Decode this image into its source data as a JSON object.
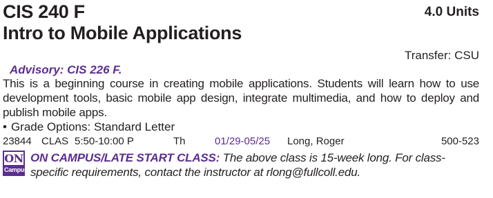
{
  "course": {
    "code": "CIS 240 F",
    "units": "4.0 Units",
    "title": "Intro to Mobile Applications",
    "transfer": "Transfer: CSU",
    "advisory": "Advisory: CIS 226 F.",
    "description": "This is a beginning course in creating mobile applications. Students will learn how to use development tools, basic mobile app design, integrate multimedia, and how to deploy and publish mobile apps.",
    "grade_options": "Grade Options: Standard Letter",
    "bullet": "•"
  },
  "section": {
    "number": "23844",
    "type": "CLAS",
    "time": "5:50-10:00 P",
    "days": "Th",
    "dates": "01/29-05/25",
    "instructor": "Long, Roger",
    "room": "500-523"
  },
  "badge": {
    "top": "ON",
    "bottom": "Campus"
  },
  "note": {
    "label": "ON CAMPUS/LATE START CLASS:",
    "text": " The above class is 15-week long. For class-specific requirements, contact the instructor at rlong@fullcoll.edu."
  },
  "colors": {
    "accent": "#5c2d91",
    "text": "#231f20"
  }
}
